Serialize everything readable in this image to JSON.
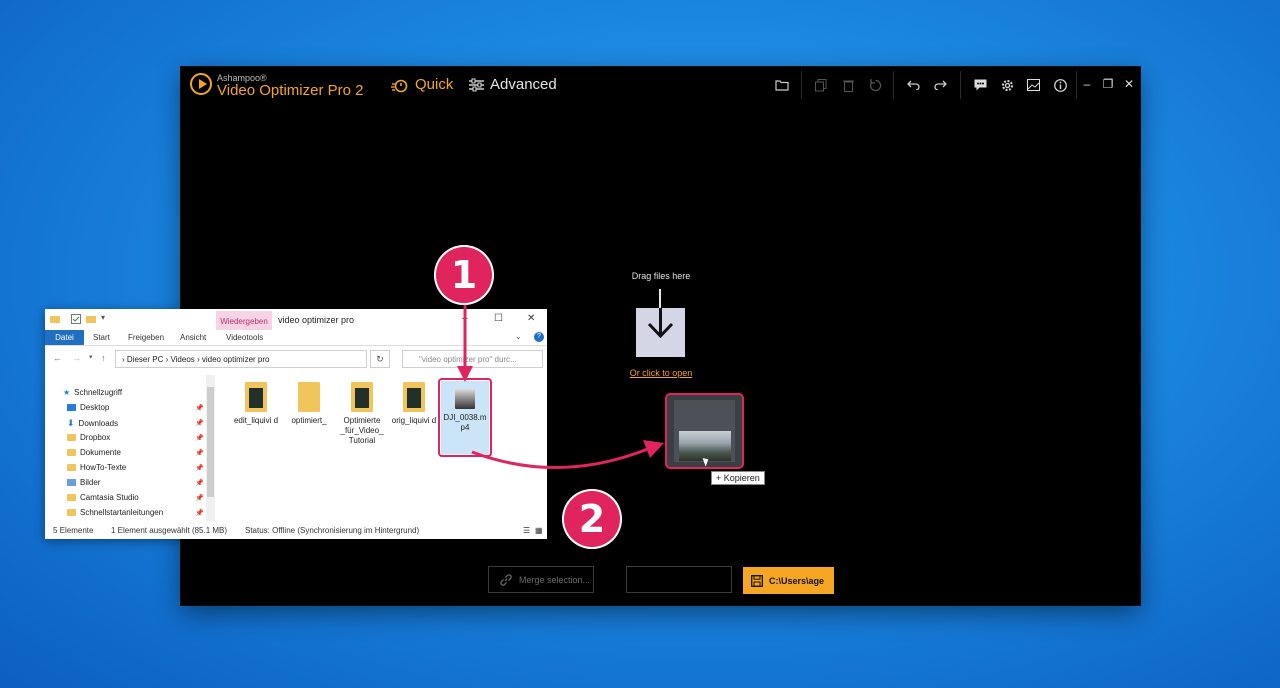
{
  "app": {
    "brand_small": "Ashampoo®",
    "brand_name": "Video Optimizer Pro 2",
    "mode_quick": "Quick",
    "mode_advanced": "Advanced",
    "drop_label": "Drag files here",
    "drop_link": "Or click to open",
    "merge_button": "Merge selection...",
    "save_path": "C:\\Users\\age",
    "copy_hint": "+ Kopieren",
    "accent": "#f5a623"
  },
  "explorer": {
    "title": "video optimizer pro",
    "context_tab": "Wiedergeben",
    "ribbon_tabs": [
      "Datei",
      "Start",
      "Freigeben",
      "Ansicht",
      "Videotools"
    ],
    "address": "›  Dieser PC  ›  Videos  ›  video optimizer pro",
    "search_placeholder": "\"video optimizer pro\" durc...",
    "sidebar": [
      {
        "label": "Schnellzugriff",
        "icon": "star-icon"
      },
      {
        "label": "Desktop",
        "icon": "desktop-icon"
      },
      {
        "label": "Downloads",
        "icon": "download-icon"
      },
      {
        "label": "Dropbox",
        "icon": "folder-icon"
      },
      {
        "label": "Dokumente",
        "icon": "folder-icon"
      },
      {
        "label": "HowTo-Texte",
        "icon": "folder-icon"
      },
      {
        "label": "Bilder",
        "icon": "picture-icon"
      },
      {
        "label": "Camtasia Studio",
        "icon": "folder-icon"
      },
      {
        "label": "Schnellstartanleitungen",
        "icon": "folder-icon"
      }
    ],
    "files": [
      {
        "label": "edit_liquivi d"
      },
      {
        "label": "optimiert_"
      },
      {
        "label": "Optimierte _für_Video_ Tutorial"
      },
      {
        "label": "orig_liquivi d"
      },
      {
        "label": "DJI_0038.m p4"
      }
    ],
    "status_count": "5 Elemente",
    "status_selected": "1 Element ausgewählt (85.1 MB)",
    "status_sync": "Status:  Offline (Synchronisierung im Hintergrund)"
  },
  "annotations": {
    "step1": "1",
    "step2": "2",
    "color": "#e0245e"
  }
}
